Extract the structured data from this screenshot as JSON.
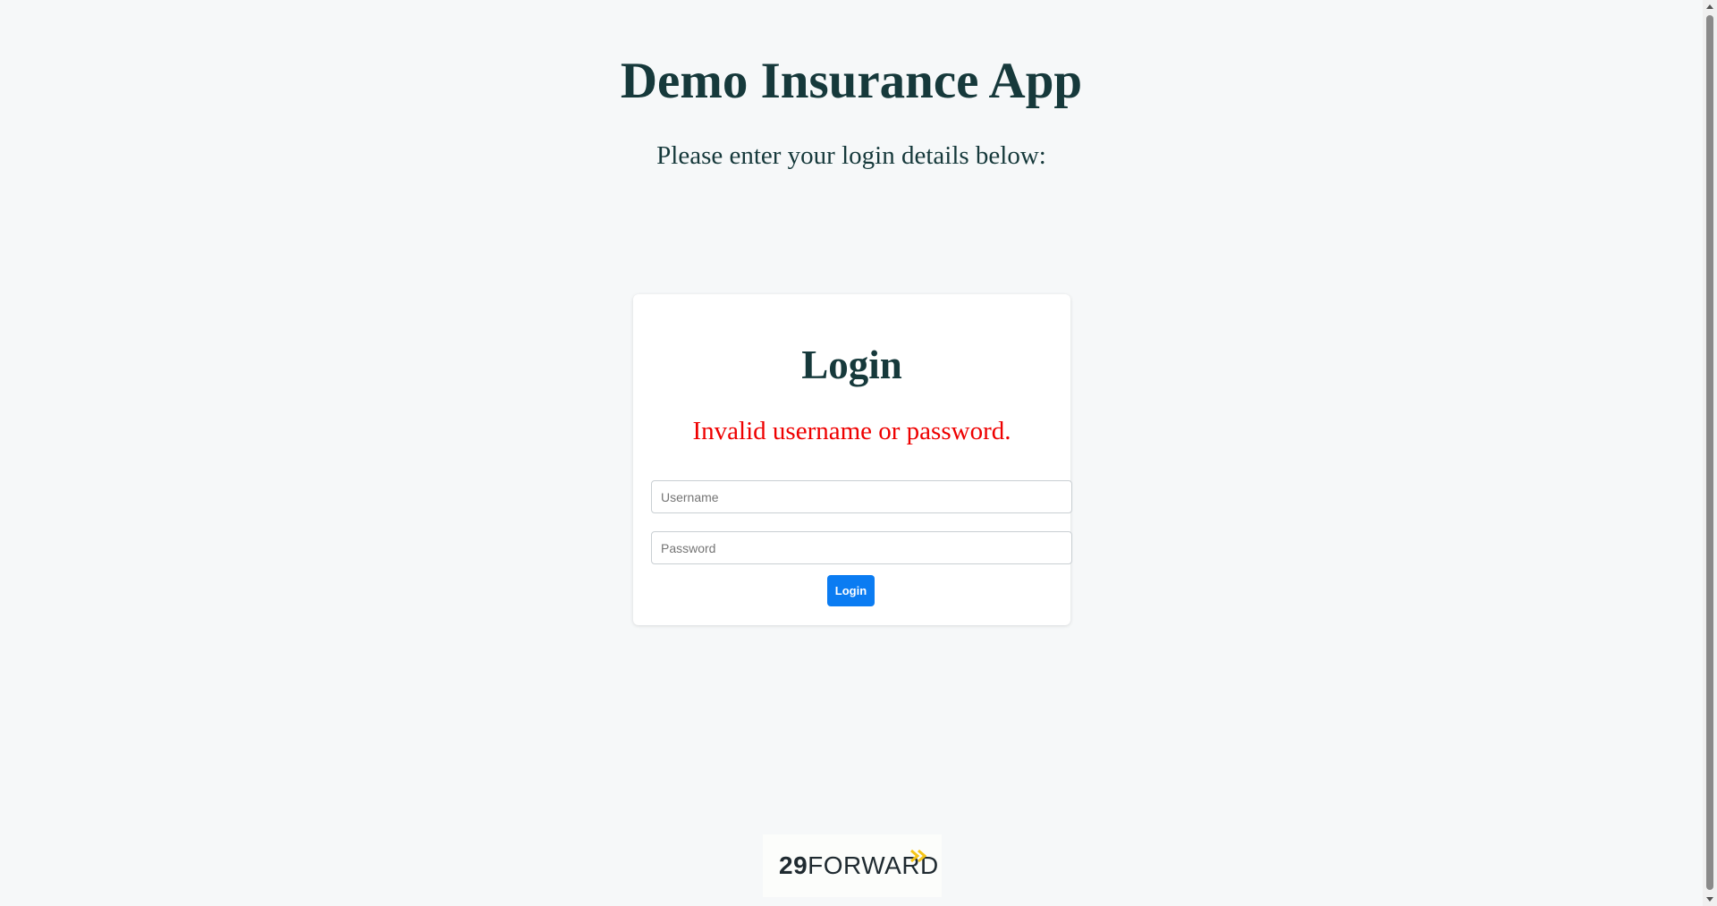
{
  "header": {
    "title": "Demo Insurance App",
    "subtitle": "Please enter your login details below:"
  },
  "login_card": {
    "title": "Login",
    "error_message": "Invalid username or password.",
    "username_placeholder": "Username",
    "password_placeholder": "Password",
    "username_value": "",
    "password_value": "",
    "submit_label": "Login"
  },
  "footer": {
    "logo": {
      "text": "29FORWARD",
      "icon": "double-chevron-right-icon"
    }
  },
  "colors": {
    "background": "#f6f8f9",
    "heading": "#16393b",
    "error": "#ee0000",
    "button": "#0b7cf2",
    "logo_accent": "#f5c518"
  }
}
